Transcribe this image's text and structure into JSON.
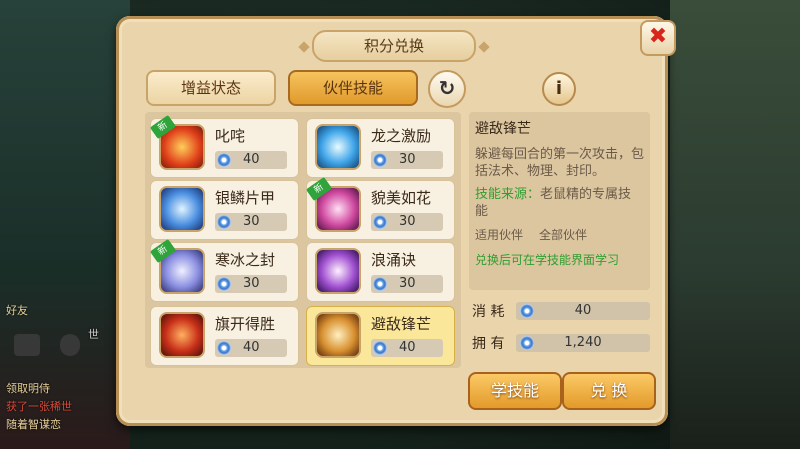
{
  "dialog": {
    "title": "积分兑换"
  },
  "tabs": [
    {
      "label": "增益状态"
    },
    {
      "label": "伙伴技能"
    }
  ],
  "controls": {
    "close_glyph": "✖",
    "refresh_glyph": "↻",
    "info_glyph": "i"
  },
  "items": [
    {
      "name": "叱咤",
      "cost": "40",
      "new": true,
      "selected": false
    },
    {
      "name": "龙之激励",
      "cost": "30",
      "new": false,
      "selected": false
    },
    {
      "name": "银鳞片甲",
      "cost": "30",
      "new": false,
      "selected": false
    },
    {
      "name": "貌美如花",
      "cost": "30",
      "new": true,
      "selected": false
    },
    {
      "name": "寒冰之封",
      "cost": "30",
      "new": true,
      "selected": false
    },
    {
      "name": "浪涌诀",
      "cost": "30",
      "new": false,
      "selected": false
    },
    {
      "name": "旗开得胜",
      "cost": "40",
      "new": false,
      "selected": false
    },
    {
      "name": "避敌锋芒",
      "cost": "40",
      "new": false,
      "selected": true
    }
  ],
  "new_badge_label": "新",
  "detail": {
    "title": "避敌锋芒",
    "description": "躲避每回合的第一次攻击，包括法术、物理、封印。",
    "source_label": "技能来源：",
    "source_value": "老鼠精的专属技能",
    "partner_label": "适用伙伴",
    "partner_value": "全部伙伴",
    "note": "兑换后可在学技能界面学习"
  },
  "stats": {
    "consume_label": "消 耗",
    "consume_value": "40",
    "own_label": "拥 有",
    "own_value": "1,240"
  },
  "buttons": {
    "learn": "学技能",
    "exchange": "兑 换"
  },
  "background": {
    "chat_lines": [
      "世",
      "领取明侍",
      "获了一张稀世",
      "随着智谋恋"
    ],
    "left_label": "好友"
  }
}
